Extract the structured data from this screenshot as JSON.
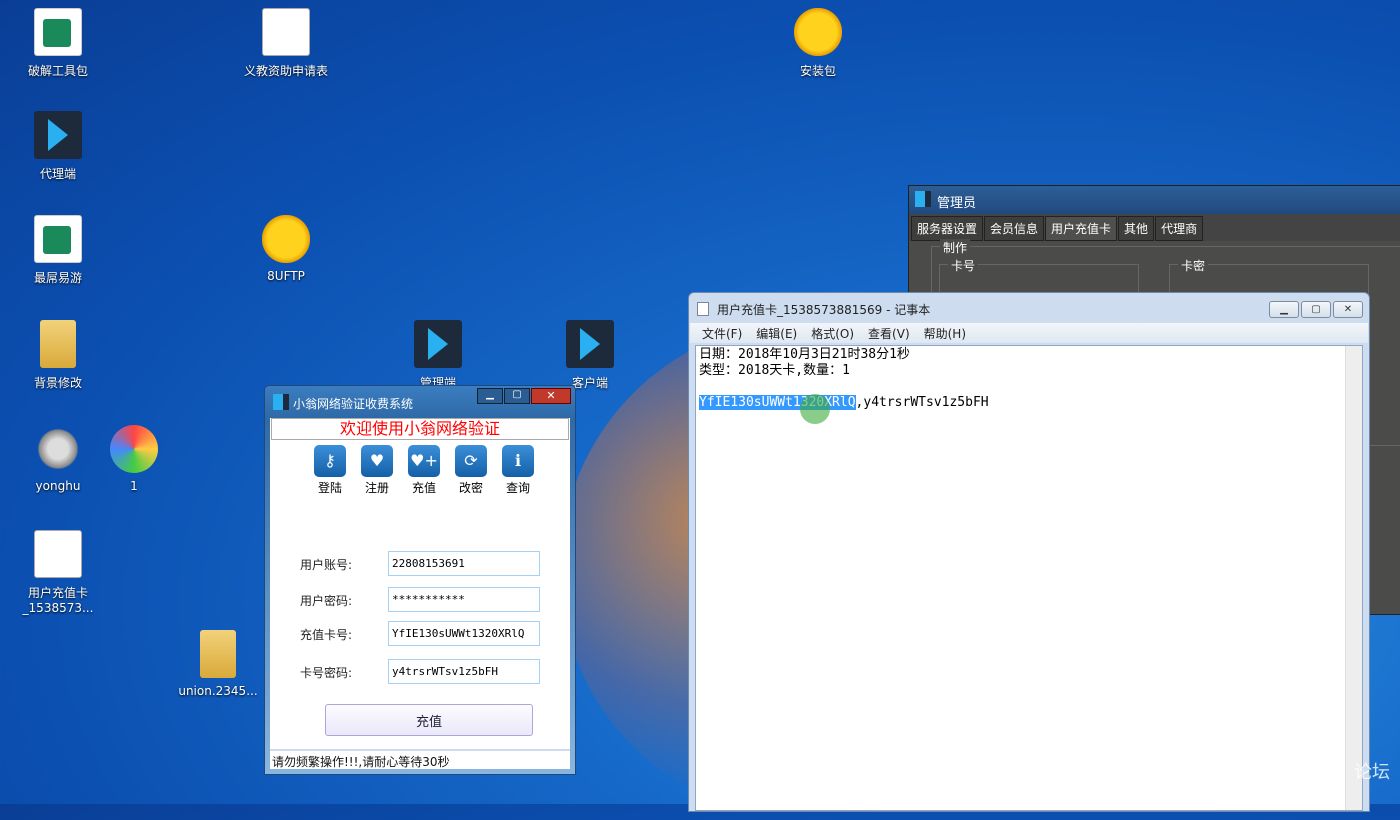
{
  "desktop": {
    "icons": [
      {
        "label": "破解工具包",
        "kind": "green"
      },
      {
        "label": "代理端",
        "kind": "bird"
      },
      {
        "label": "最屌易游",
        "kind": "green"
      },
      {
        "label": "背景修改",
        "kind": "folder"
      },
      {
        "label": "yonghu",
        "kind": "gear"
      },
      {
        "label": "用户充值卡_1538573...",
        "kind": "doc"
      },
      {
        "label": "1",
        "kind": "pic"
      },
      {
        "label": "义教资助申请表",
        "kind": "doc"
      },
      {
        "label": "8UFTP",
        "kind": "ftp"
      },
      {
        "label": "union.2345...",
        "kind": "folder"
      },
      {
        "label": "管理端",
        "kind": "bird"
      },
      {
        "label": "客户端",
        "kind": "bird"
      },
      {
        "label": "安装包",
        "kind": "ftp"
      }
    ],
    "watermark": "论坛"
  },
  "admin": {
    "title": "管理员",
    "tabs": [
      "服务器设置",
      "会员信息",
      "用户充值卡",
      "其他",
      "代理商"
    ],
    "active_tab": "用户充值卡",
    "group": "制作",
    "card_no": "卡号",
    "card_pwd": "卡密"
  },
  "notepad": {
    "title": "用户充值卡_1538573881569 - 记事本",
    "menu": [
      "文件(F)",
      "编辑(E)",
      "格式(O)",
      "查看(V)",
      "帮助(H)"
    ],
    "line1": "日期：2018年10月3日21时38分1秒",
    "line2": "类型：2018天卡,数量：1",
    "selected": "YfIE130sUWWt1320XRlQ",
    "rest": ",y4trsrWTsv1z5bFH"
  },
  "client": {
    "title": "小翁网络验证收费系统",
    "banner": "欢迎使用小翁网络验证",
    "tools": [
      {
        "label": "登陆",
        "icon": "key-icon",
        "glyph": "⚷"
      },
      {
        "label": "注册",
        "icon": "heart-icon",
        "glyph": "♥"
      },
      {
        "label": "充值",
        "icon": "heart-plus-icon",
        "glyph": "♥+"
      },
      {
        "label": "改密",
        "icon": "refresh-icon",
        "glyph": "⟳"
      },
      {
        "label": "查询",
        "icon": "info-icon",
        "glyph": "ℹ"
      }
    ],
    "fields": [
      {
        "label": "用户账号:",
        "value": "22808153691"
      },
      {
        "label": "用户密码:",
        "value": "***********"
      },
      {
        "label": "充值卡号:",
        "value": "YfIE130sUWWt1320XRlQ"
      },
      {
        "label": "卡号密码:",
        "value": "y4trsrWTsv1z5bFH"
      }
    ],
    "submit": "充值",
    "status": "请勿频繁操作!!!,请耐心等待30秒"
  }
}
